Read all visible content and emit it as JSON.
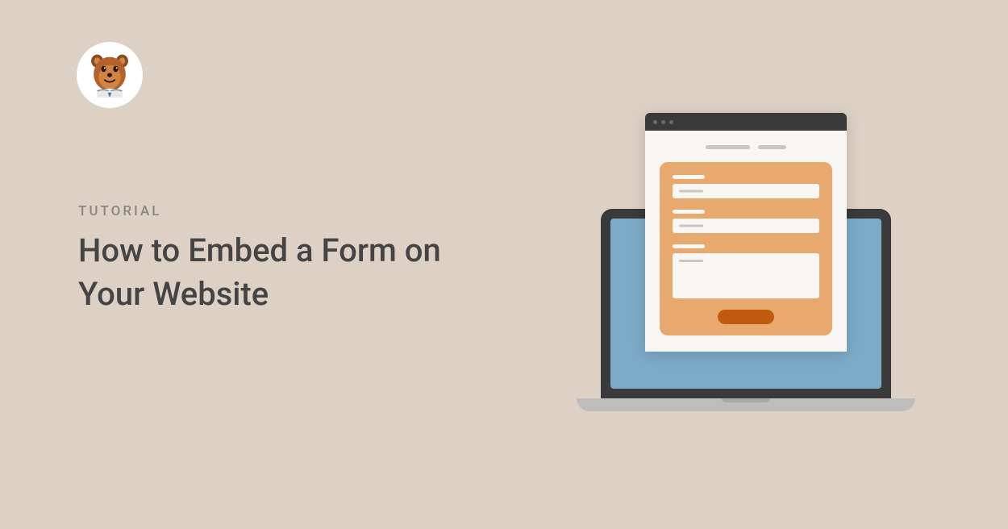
{
  "category": "TUTORIAL",
  "title": "How to Embed a Form on Your Website",
  "logo": {
    "name": "wpforms-bear-mascot"
  },
  "colors": {
    "background": "#ddd1c6",
    "title_text": "#444444",
    "category_text": "#8a8580",
    "laptop_screen": "#7cabc8",
    "form_card": "#e8a96e",
    "submit_button": "#c05a0e",
    "browser_bar": "#3a3a3a"
  }
}
